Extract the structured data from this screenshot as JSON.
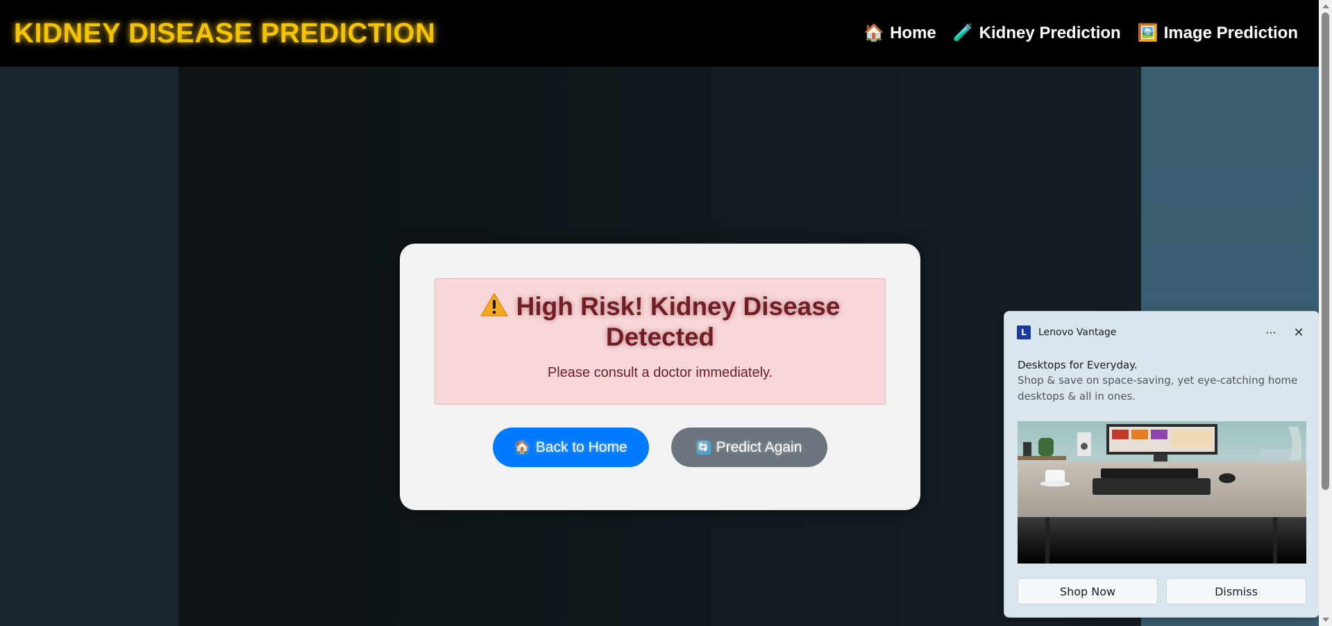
{
  "navbar": {
    "brand": "KIDNEY DISEASE PREDICTION",
    "links": [
      {
        "icon": "🏠",
        "label": "Home"
      },
      {
        "icon": "🧪",
        "label": "Kidney Prediction"
      },
      {
        "icon": "🖼️",
        "label": "Image Prediction"
      }
    ]
  },
  "result": {
    "title": "High Risk! Kidney Disease Detected",
    "message": "Please consult a doctor immediately.",
    "buttons": {
      "home_icon": "🏠",
      "home_label": "Back to Home",
      "again_icon": "🔄",
      "again_label": "Predict Again"
    }
  },
  "notification": {
    "app_logo": "L",
    "app_name": "Lenovo Vantage",
    "more": "···",
    "close": "✕",
    "title": "Desktops for Everyday.",
    "text": "Shop & save on space-saving, yet eye-catching home desktops & all in ones.",
    "actions": {
      "primary": "Shop Now",
      "secondary": "Dismiss"
    }
  },
  "colors": {
    "brand": "#f5c400",
    "primary_button": "#007bff",
    "secondary_button": "#6c757d",
    "alert_bg": "#f8d7da",
    "alert_text": "#721c24"
  }
}
